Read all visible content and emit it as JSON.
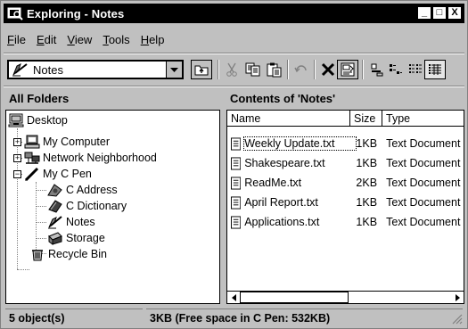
{
  "window": {
    "title": "Exploring - Notes",
    "controls": {
      "minimize": "_",
      "maximize": "□",
      "close": "X"
    }
  },
  "menu": {
    "items": [
      {
        "accel": "F",
        "rest": "ile"
      },
      {
        "accel": "E",
        "rest": "dit"
      },
      {
        "accel": "V",
        "rest": "iew"
      },
      {
        "accel": "T",
        "rest": "ools"
      },
      {
        "accel": "H",
        "rest": "elp"
      }
    ]
  },
  "toolbar": {
    "location_value": "Notes",
    "buttons": [
      "up-one-level-icon",
      "cut-icon",
      "copy-icon",
      "paste-icon",
      "undo-icon",
      "delete-icon",
      "properties-icon",
      "large-icons-icon",
      "small-icons-icon",
      "list-icon",
      "details-icon"
    ]
  },
  "panes": {
    "left_header": "All Folders",
    "right_header": "Contents of 'Notes'"
  },
  "tree": {
    "items": [
      {
        "label": "Desktop",
        "icon": "desktop-icon"
      },
      {
        "label": "My Computer",
        "icon": "computer-icon",
        "expander": "+"
      },
      {
        "label": "Network Neighborhood",
        "icon": "network-icon",
        "expander": "+"
      },
      {
        "label": "My C Pen",
        "icon": "pen-icon",
        "expander": "−"
      },
      {
        "label": "C Address",
        "icon": "address-book-icon"
      },
      {
        "label": "C Dictionary",
        "icon": "dictionary-icon"
      },
      {
        "label": "Notes",
        "icon": "notes-icon"
      },
      {
        "label": "Storage",
        "icon": "storage-icon"
      },
      {
        "label": "Recycle Bin",
        "icon": "recycle-bin-icon"
      }
    ]
  },
  "contents": {
    "columns": [
      "Name",
      "Size",
      "Type"
    ],
    "files": [
      {
        "name": "Weekly Update.txt",
        "size": "1KB",
        "type": "Text Document"
      },
      {
        "name": "Shakespeare.txt",
        "size": "1KB",
        "type": "Text Document"
      },
      {
        "name": "ReadMe.txt",
        "size": "2KB",
        "type": "Text Document"
      },
      {
        "name": "April Report.txt",
        "size": "1KB",
        "type": "Text Document"
      },
      {
        "name": "Applications.txt",
        "size": "1KB",
        "type": "Text Document"
      }
    ]
  },
  "status": {
    "objects": "5 object(s)",
    "space": "3KB (Free space in C Pen: 532KB)"
  }
}
